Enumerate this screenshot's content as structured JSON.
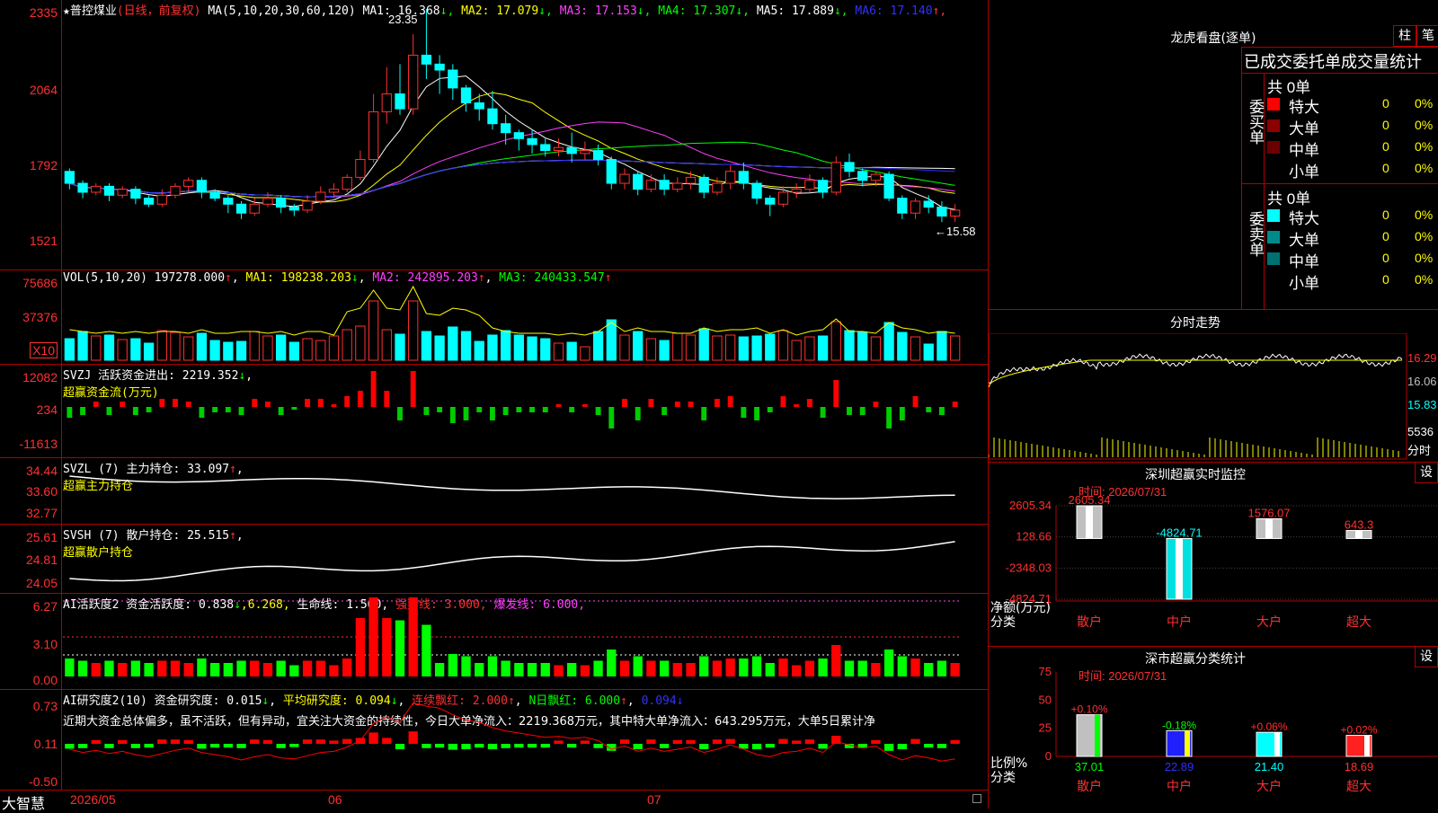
{
  "stock": {
    "star": "★",
    "name": "普控煤业",
    "period": "(日线，前复权)",
    "ma_params": "MA(5,10,20,30,60,120)",
    "ma": [
      {
        "label": "MA1:",
        "value": "16.368",
        "arrow": "↓",
        "color": "#ffffff"
      },
      {
        "label": "MA2:",
        "value": "17.079",
        "arrow": "↓",
        "color": "#ffff00"
      },
      {
        "label": "MA3:",
        "value": "17.153",
        "arrow": "↓",
        "color": "#ff40ff"
      },
      {
        "label": "MA4:",
        "value": "17.307",
        "arrow": "↓",
        "color": "#00ff00"
      },
      {
        "label": "MA5:",
        "value": "17.889",
        "arrow": "↓",
        "color": "#ffffff"
      },
      {
        "label": "MA6:",
        "value": "17.140",
        "arrow": "↑",
        "color": "#3030ff"
      }
    ],
    "high_mark": "23.35",
    "low_mark": "←15.58",
    "y_ticks": [
      "2335",
      "2064",
      "1792",
      "1521"
    ]
  },
  "volume": {
    "title": "VOL(5,10,20)",
    "value": "197278.000",
    "value_arrow": "↑",
    "ma1": "MA1: 198238.203",
    "ma1_arrow": "↓",
    "ma2": "MA2: 242895.203",
    "ma2_arrow": "↑",
    "ma3": "MA3: 240433.547",
    "ma3_arrow": "↑",
    "y_ticks": [
      "75686",
      "37376"
    ],
    "unit": "X10"
  },
  "svzj": {
    "title": "SVZJ  活跃资金进出: 2219.352",
    "arrow": "↓",
    "sub": "超赢资金流(万元)",
    "y_ticks": [
      "12082",
      "234",
      "-11613"
    ]
  },
  "svzl": {
    "title": "SVZL (7) 主力持仓: 33.097",
    "arrow": "↑",
    "sub": "超赢主力持仓",
    "y_ticks": [
      "34.44",
      "33.60",
      "32.77"
    ]
  },
  "svsh": {
    "title": "SVSH (7) 散户持仓: 25.515",
    "arrow": "↑",
    "sub": "超赢散户持仓",
    "y_ticks": [
      "25.61",
      "24.81",
      "24.05"
    ]
  },
  "ai1": {
    "title": "AI活跃度2 资金活跃度: 0.838",
    "arrow": "↓",
    "p2": ",6.268,",
    "p3": "生命线: 1.560,",
    "p4": "强势线: 3.000,",
    "p5": "爆发线: 6.000,",
    "y_ticks": [
      "6.27",
      "3.10",
      "0.00"
    ]
  },
  "ai2": {
    "title": "AI研究度2(10) 资金研究度: 0.015",
    "arrow": "↓",
    "p2": "平均研究度: 0.094",
    "p2_arrow": "↓",
    "p3": "连续飘红: 2.000",
    "p3_arrow": "↑",
    "p4": "N日飘红: 6.000",
    "p4_arrow": "↑",
    "p5": "0.094",
    "p5_arrow": "↓",
    "comment": "近期大资金总体偏多，虽不活跃，但有异动，宜关注大资金的持续性，今日大单净流入：2219.368万元，其中特大单净流入：643.295万元，大单5日累计净",
    "y_ticks": [
      "0.73",
      "0.11",
      "-0.50"
    ]
  },
  "bottom": {
    "brand": "大智慧",
    "dates": [
      "2026/05",
      "06",
      "07"
    ]
  },
  "right": {
    "lhb_title": "龙虎看盘(逐单)",
    "btn_zhu": "柱",
    "btn_bi": "笔",
    "header": "已成交委托单成交量统计",
    "buy_total": "共 0单",
    "buy_label": "委买单",
    "sell_total": "共 0单",
    "sell_label": "委卖单",
    "rows": [
      {
        "name": "特大",
        "v": "0",
        "p": "0%"
      },
      {
        "name": "大单",
        "v": "0",
        "p": "0%"
      },
      {
        "name": "中单",
        "v": "0",
        "p": "0%"
      },
      {
        "name": "小单",
        "v": "0",
        "p": "0%"
      }
    ],
    "buy_colors": [
      "#ff0000",
      "#8b0000",
      "#6b0000",
      ""
    ],
    "sell_colors": [
      "#00ffff",
      "#008b8b",
      "#007070",
      ""
    ],
    "intraday_title": "分时走势",
    "intraday_ticks": [
      "16.29",
      "16.06",
      "15.83"
    ],
    "intraday_vol": "5536",
    "intraday_label": "分时",
    "monitor_title": "深圳超赢实时监控",
    "monitor_btn": "设",
    "monitor_time": "时间: 2026/07/31",
    "monitor_ticks": [
      "2605.34",
      "128.66",
      "-2348.03",
      "-4824.71"
    ],
    "monitor_ylabel1": "净额(万元)",
    "monitor_ylabel2": "分类",
    "monitor_bars": [
      {
        "cat": "散户",
        "value": 2605.34,
        "label": "2605.34"
      },
      {
        "cat": "中户",
        "value": -4824.71,
        "label": "-4824.71"
      },
      {
        "cat": "大户",
        "value": 1576.07,
        "label": "1576.07"
      },
      {
        "cat": "超大",
        "value": 643.3,
        "label": "643.3"
      }
    ],
    "class_title": "深市超赢分类统计",
    "class_btn": "设",
    "class_time": "时间: 2026/07/31",
    "class_ticks": [
      "75",
      "50",
      "25",
      "0"
    ],
    "class_ylabel1": "比例%",
    "class_ylabel2": "分类",
    "class_bars": [
      {
        "cat": "散户",
        "value": 37.01,
        "label": "37.01",
        "chg": "+0.10%"
      },
      {
        "cat": "中户",
        "value": 22.89,
        "label": "22.89",
        "chg": "-0.18%"
      },
      {
        "cat": "大户",
        "value": 21.4,
        "label": "21.40",
        "chg": "+0.06%"
      },
      {
        "cat": "超大",
        "value": 18.69,
        "label": "18.69",
        "chg": "+0.02%"
      }
    ]
  },
  "chart_data": [
    {
      "type": "candlestick",
      "title": "普控煤业",
      "series_note": "daily OHLC with MA lines",
      "ylim": [
        15.21,
        23.35
      ],
      "ohlc": [
        [
          17.9,
          17.5,
          18.0,
          17.3
        ],
        [
          17.5,
          17.2,
          17.6,
          17.0
        ],
        [
          17.2,
          17.4,
          17.5,
          17.1
        ],
        [
          17.4,
          17.1,
          17.5,
          16.9
        ],
        [
          17.1,
          17.3,
          17.4,
          17.0
        ],
        [
          17.3,
          17.0,
          17.4,
          16.8
        ],
        [
          17.0,
          16.8,
          17.1,
          16.7
        ],
        [
          16.8,
          17.1,
          17.3,
          16.7
        ],
        [
          17.1,
          17.4,
          17.5,
          17.0
        ],
        [
          17.4,
          17.6,
          17.7,
          17.2
        ],
        [
          17.6,
          17.2,
          17.7,
          17.0
        ],
        [
          17.2,
          17.0,
          17.3,
          16.9
        ],
        [
          17.0,
          16.8,
          17.1,
          16.5
        ],
        [
          16.8,
          16.5,
          16.9,
          16.3
        ],
        [
          16.5,
          16.8,
          17.0,
          16.4
        ],
        [
          16.8,
          17.0,
          17.2,
          16.7
        ],
        [
          17.0,
          16.7,
          17.1,
          16.5
        ],
        [
          16.7,
          16.6,
          16.8,
          16.4
        ],
        [
          16.6,
          16.9,
          17.1,
          16.5
        ],
        [
          16.9,
          17.2,
          17.4,
          16.8
        ],
        [
          17.2,
          17.3,
          17.5,
          17.0
        ],
        [
          17.3,
          17.7,
          17.8,
          17.2
        ],
        [
          17.7,
          18.3,
          18.6,
          17.6
        ],
        [
          18.3,
          19.9,
          20.5,
          18.2
        ],
        [
          19.9,
          20.5,
          21.4,
          19.5
        ],
        [
          20.5,
          20.0,
          21.5,
          19.8
        ],
        [
          20.0,
          21.8,
          22.5,
          19.8
        ],
        [
          21.8,
          21.5,
          23.35,
          21.0
        ],
        [
          21.5,
          21.3,
          21.8,
          20.5
        ],
        [
          21.3,
          20.7,
          21.5,
          20.3
        ],
        [
          20.7,
          20.2,
          20.8,
          19.9
        ],
        [
          20.2,
          20.0,
          20.5,
          19.6
        ],
        [
          20.0,
          19.5,
          20.6,
          19.3
        ],
        [
          19.5,
          19.2,
          19.8,
          18.8
        ],
        [
          19.2,
          19.0,
          19.3,
          18.6
        ],
        [
          19.0,
          18.8,
          19.3,
          18.5
        ],
        [
          18.8,
          18.6,
          19.0,
          18.4
        ],
        [
          18.6,
          18.7,
          19.0,
          18.4
        ],
        [
          18.7,
          18.5,
          19.2,
          18.2
        ],
        [
          18.5,
          18.6,
          18.9,
          18.3
        ],
        [
          18.6,
          18.3,
          18.8,
          18.1
        ],
        [
          18.3,
          17.5,
          18.4,
          17.3
        ],
        [
          17.5,
          17.8,
          18.0,
          17.3
        ],
        [
          17.8,
          17.3,
          17.9,
          17.1
        ],
        [
          17.3,
          17.6,
          17.8,
          17.2
        ],
        [
          17.6,
          17.3,
          17.8,
          17.1
        ],
        [
          17.3,
          17.5,
          17.7,
          17.2
        ],
        [
          17.5,
          17.7,
          17.9,
          17.3
        ],
        [
          17.7,
          17.2,
          17.8,
          17.0
        ],
        [
          17.2,
          17.5,
          17.7,
          17.1
        ],
        [
          17.5,
          17.9,
          18.1,
          17.3
        ],
        [
          17.9,
          17.5,
          18.2,
          17.3
        ],
        [
          17.5,
          17.0,
          17.6,
          16.8
        ],
        [
          17.0,
          16.8,
          17.1,
          16.4
        ],
        [
          16.8,
          17.2,
          17.4,
          16.7
        ],
        [
          17.2,
          17.3,
          17.5,
          17.0
        ],
        [
          17.3,
          17.6,
          17.8,
          17.2
        ],
        [
          17.6,
          17.2,
          17.7,
          17.0
        ],
        [
          17.2,
          18.2,
          18.4,
          17.1
        ],
        [
          18.2,
          17.9,
          18.5,
          17.7
        ],
        [
          17.9,
          17.6,
          18.0,
          17.4
        ],
        [
          17.6,
          17.8,
          17.9,
          17.4
        ],
        [
          17.8,
          17.0,
          17.9,
          16.9
        ],
        [
          17.0,
          16.5,
          17.1,
          16.3
        ],
        [
          16.5,
          16.9,
          17.0,
          16.3
        ],
        [
          16.9,
          16.7,
          17.1,
          16.5
        ],
        [
          16.7,
          16.4,
          16.9,
          16.2
        ],
        [
          16.4,
          16.6,
          16.8,
          16.2
        ]
      ]
    },
    {
      "type": "bar",
      "title": "分类比例",
      "categories": [
        "散户",
        "中户",
        "大户",
        "超大"
      ],
      "values": [
        37.01,
        22.89,
        21.4,
        18.69
      ],
      "ylim": [
        0,
        75
      ]
    },
    {
      "type": "bar",
      "title": "净额(万元)",
      "categories": [
        "散户",
        "中户",
        "大户",
        "超大"
      ],
      "values": [
        2605.34,
        -4824.71,
        1576.07,
        643.3
      ],
      "ylim": [
        -4824.71,
        2605.34
      ]
    }
  ]
}
